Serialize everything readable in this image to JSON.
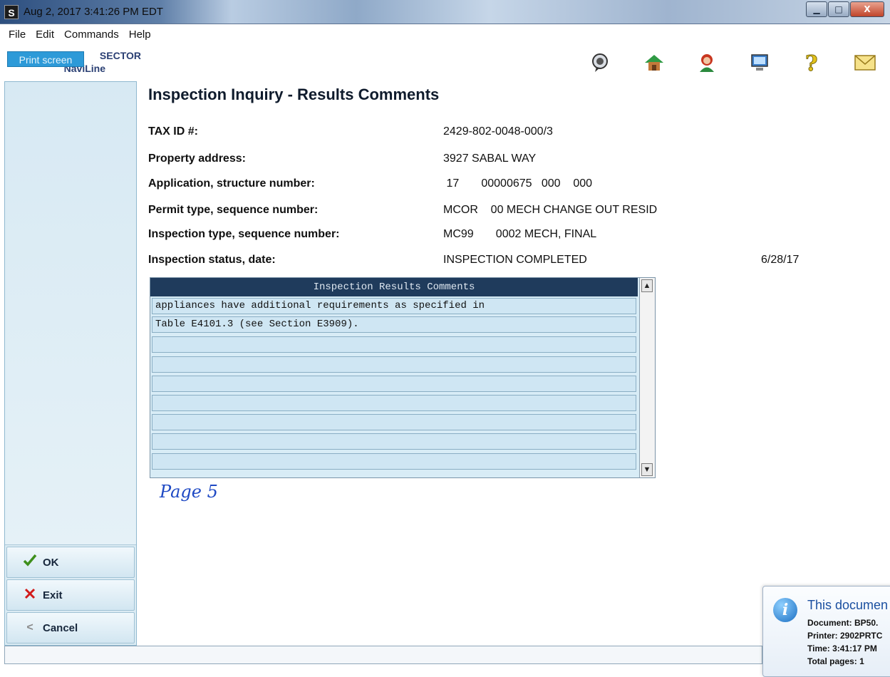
{
  "window": {
    "app_badge": "S",
    "title": "Aug 2, 2017  3:41:26 PM EDT",
    "controls": {
      "minimize": "▁",
      "maximize": "□",
      "close": "X"
    }
  },
  "menu": {
    "file": "File",
    "edit": "Edit",
    "commands": "Commands",
    "help": "Help"
  },
  "logo": {
    "line1": "SECTOR",
    "line2": "NaviLine"
  },
  "print_button": "Print screen",
  "toolbar_icons": [
    "speech-bubble-icon",
    "house-icon",
    "person-icon",
    "computer-icon",
    "question-icon",
    "envelope-icon"
  ],
  "page_title": "Inspection Inquiry - Results Comments",
  "fields": {
    "tax_id": {
      "label": "TAX ID #:",
      "value": "2429-802-0048-000/3"
    },
    "address": {
      "label": "Property address:",
      "value": "3927 SABAL WAY"
    },
    "application": {
      "label": "Application, structure number:",
      "value": " 17       00000675   000    000"
    },
    "permit": {
      "label": "Permit type, sequence number:",
      "value": "MCOR    00 MECH CHANGE OUT RESID"
    },
    "inspection_type": {
      "label": "Inspection type, sequence number:",
      "value": "MC99       0002 MECH, FINAL"
    },
    "status": {
      "label": "Inspection status, date:",
      "value": "INSPECTION COMPLETED",
      "date": "6/28/17"
    }
  },
  "comments": {
    "header": "Inspection Results Comments",
    "rows": [
      "appliances have additional requirements as specified in",
      "Table E4101.3 (see Section E3909).",
      "",
      "",
      "",
      "",
      "",
      "",
      "",
      "",
      ""
    ]
  },
  "handwritten_note": "Page 5",
  "sidebar": {
    "ok": "OK",
    "exit": "Exit",
    "cancel": "Cancel"
  },
  "toast": {
    "title": "This documen",
    "document": "Document: BP50.",
    "printer": "Printer: 2902PRTC",
    "time": "Time: 3:41:17 PM",
    "pages": "Total pages: 1"
  },
  "colors": {
    "header_bg": "#1f3b5c",
    "row_bg": "#cfe6f3",
    "sidebar_bg": "#dcecf4",
    "ink_blue": "#1e49c4"
  }
}
